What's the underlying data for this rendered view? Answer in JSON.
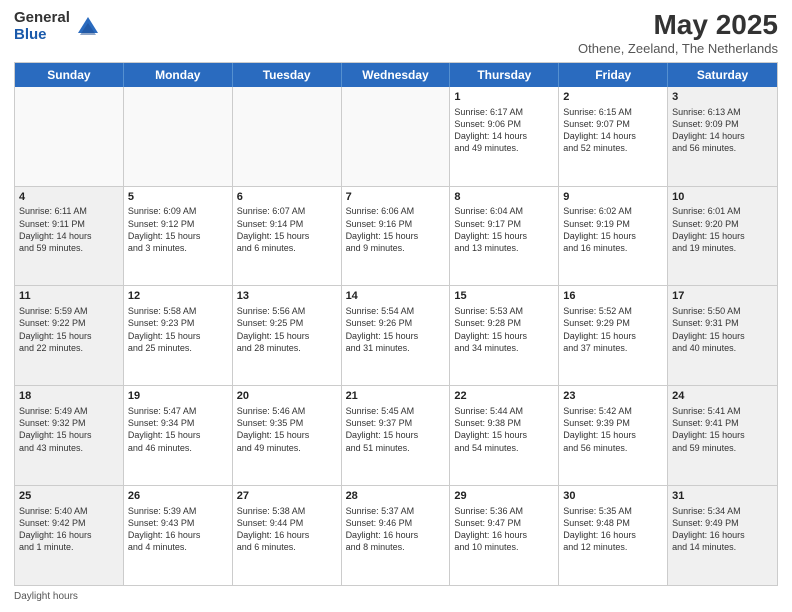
{
  "logo": {
    "general": "General",
    "blue": "Blue"
  },
  "title": {
    "month": "May 2025",
    "location": "Othene, Zeeland, The Netherlands"
  },
  "header_days": [
    "Sunday",
    "Monday",
    "Tuesday",
    "Wednesday",
    "Thursday",
    "Friday",
    "Saturday"
  ],
  "footer": {
    "daylight_hours": "Daylight hours"
  },
  "weeks": [
    [
      {
        "day": "",
        "text": "",
        "empty": true
      },
      {
        "day": "",
        "text": "",
        "empty": true
      },
      {
        "day": "",
        "text": "",
        "empty": true
      },
      {
        "day": "",
        "text": "",
        "empty": true
      },
      {
        "day": "1",
        "text": "Sunrise: 6:17 AM\nSunset: 9:06 PM\nDaylight: 14 hours\nand 49 minutes.",
        "empty": false
      },
      {
        "day": "2",
        "text": "Sunrise: 6:15 AM\nSunset: 9:07 PM\nDaylight: 14 hours\nand 52 minutes.",
        "empty": false
      },
      {
        "day": "3",
        "text": "Sunrise: 6:13 AM\nSunset: 9:09 PM\nDaylight: 14 hours\nand 56 minutes.",
        "empty": false
      }
    ],
    [
      {
        "day": "4",
        "text": "Sunrise: 6:11 AM\nSunset: 9:11 PM\nDaylight: 14 hours\nand 59 minutes.",
        "empty": false
      },
      {
        "day": "5",
        "text": "Sunrise: 6:09 AM\nSunset: 9:12 PM\nDaylight: 15 hours\nand 3 minutes.",
        "empty": false
      },
      {
        "day": "6",
        "text": "Sunrise: 6:07 AM\nSunset: 9:14 PM\nDaylight: 15 hours\nand 6 minutes.",
        "empty": false
      },
      {
        "day": "7",
        "text": "Sunrise: 6:06 AM\nSunset: 9:16 PM\nDaylight: 15 hours\nand 9 minutes.",
        "empty": false
      },
      {
        "day": "8",
        "text": "Sunrise: 6:04 AM\nSunset: 9:17 PM\nDaylight: 15 hours\nand 13 minutes.",
        "empty": false
      },
      {
        "day": "9",
        "text": "Sunrise: 6:02 AM\nSunset: 9:19 PM\nDaylight: 15 hours\nand 16 minutes.",
        "empty": false
      },
      {
        "day": "10",
        "text": "Sunrise: 6:01 AM\nSunset: 9:20 PM\nDaylight: 15 hours\nand 19 minutes.",
        "empty": false
      }
    ],
    [
      {
        "day": "11",
        "text": "Sunrise: 5:59 AM\nSunset: 9:22 PM\nDaylight: 15 hours\nand 22 minutes.",
        "empty": false
      },
      {
        "day": "12",
        "text": "Sunrise: 5:58 AM\nSunset: 9:23 PM\nDaylight: 15 hours\nand 25 minutes.",
        "empty": false
      },
      {
        "day": "13",
        "text": "Sunrise: 5:56 AM\nSunset: 9:25 PM\nDaylight: 15 hours\nand 28 minutes.",
        "empty": false
      },
      {
        "day": "14",
        "text": "Sunrise: 5:54 AM\nSunset: 9:26 PM\nDaylight: 15 hours\nand 31 minutes.",
        "empty": false
      },
      {
        "day": "15",
        "text": "Sunrise: 5:53 AM\nSunset: 9:28 PM\nDaylight: 15 hours\nand 34 minutes.",
        "empty": false
      },
      {
        "day": "16",
        "text": "Sunrise: 5:52 AM\nSunset: 9:29 PM\nDaylight: 15 hours\nand 37 minutes.",
        "empty": false
      },
      {
        "day": "17",
        "text": "Sunrise: 5:50 AM\nSunset: 9:31 PM\nDaylight: 15 hours\nand 40 minutes.",
        "empty": false
      }
    ],
    [
      {
        "day": "18",
        "text": "Sunrise: 5:49 AM\nSunset: 9:32 PM\nDaylight: 15 hours\nand 43 minutes.",
        "empty": false
      },
      {
        "day": "19",
        "text": "Sunrise: 5:47 AM\nSunset: 9:34 PM\nDaylight: 15 hours\nand 46 minutes.",
        "empty": false
      },
      {
        "day": "20",
        "text": "Sunrise: 5:46 AM\nSunset: 9:35 PM\nDaylight: 15 hours\nand 49 minutes.",
        "empty": false
      },
      {
        "day": "21",
        "text": "Sunrise: 5:45 AM\nSunset: 9:37 PM\nDaylight: 15 hours\nand 51 minutes.",
        "empty": false
      },
      {
        "day": "22",
        "text": "Sunrise: 5:44 AM\nSunset: 9:38 PM\nDaylight: 15 hours\nand 54 minutes.",
        "empty": false
      },
      {
        "day": "23",
        "text": "Sunrise: 5:42 AM\nSunset: 9:39 PM\nDaylight: 15 hours\nand 56 minutes.",
        "empty": false
      },
      {
        "day": "24",
        "text": "Sunrise: 5:41 AM\nSunset: 9:41 PM\nDaylight: 15 hours\nand 59 minutes.",
        "empty": false
      }
    ],
    [
      {
        "day": "25",
        "text": "Sunrise: 5:40 AM\nSunset: 9:42 PM\nDaylight: 16 hours\nand 1 minute.",
        "empty": false
      },
      {
        "day": "26",
        "text": "Sunrise: 5:39 AM\nSunset: 9:43 PM\nDaylight: 16 hours\nand 4 minutes.",
        "empty": false
      },
      {
        "day": "27",
        "text": "Sunrise: 5:38 AM\nSunset: 9:44 PM\nDaylight: 16 hours\nand 6 minutes.",
        "empty": false
      },
      {
        "day": "28",
        "text": "Sunrise: 5:37 AM\nSunset: 9:46 PM\nDaylight: 16 hours\nand 8 minutes.",
        "empty": false
      },
      {
        "day": "29",
        "text": "Sunrise: 5:36 AM\nSunset: 9:47 PM\nDaylight: 16 hours\nand 10 minutes.",
        "empty": false
      },
      {
        "day": "30",
        "text": "Sunrise: 5:35 AM\nSunset: 9:48 PM\nDaylight: 16 hours\nand 12 minutes.",
        "empty": false
      },
      {
        "day": "31",
        "text": "Sunrise: 5:34 AM\nSunset: 9:49 PM\nDaylight: 16 hours\nand 14 minutes.",
        "empty": false
      }
    ]
  ]
}
